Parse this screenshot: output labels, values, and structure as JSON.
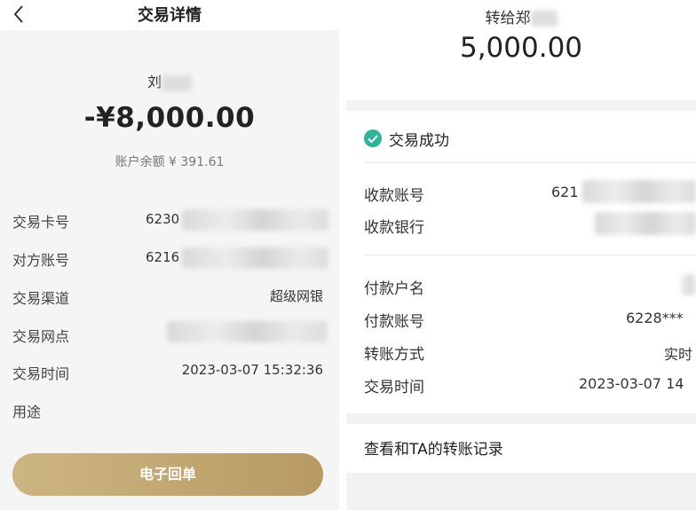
{
  "left": {
    "header": {
      "title": "交易详情"
    },
    "payee_name": "刘",
    "amount": "-¥8,000.00",
    "balance": "账户余额 ¥ 391.61",
    "rows": [
      {
        "label": "交易卡号",
        "value": "6230"
      },
      {
        "label": "对方账号",
        "value": "6216"
      },
      {
        "label": "交易渠道",
        "value": "超级网银"
      },
      {
        "label": "交易网点",
        "value": ""
      },
      {
        "label": "交易时间",
        "value": "2023-03-07 15:32:36"
      },
      {
        "label": "用途",
        "value": ""
      }
    ],
    "button": {
      "label": "电子回单"
    }
  },
  "right": {
    "header_title": "转给郑",
    "amount": "5,000.00",
    "status": "交易成功",
    "payee": [
      {
        "label": "收款账号",
        "value": "621"
      },
      {
        "label": "收款银行",
        "value": ""
      }
    ],
    "payer": [
      {
        "label": "付款户名",
        "value": ""
      },
      {
        "label": "付款账号",
        "value": "6228***"
      },
      {
        "label": "转账方式",
        "value": "实时"
      },
      {
        "label": "交易时间",
        "value": "2023-03-07 14"
      }
    ],
    "history_link": "查看和TA的转账记录"
  },
  "colors": {
    "accent_gold": "#c4a771",
    "success_green": "#2eb398"
  }
}
